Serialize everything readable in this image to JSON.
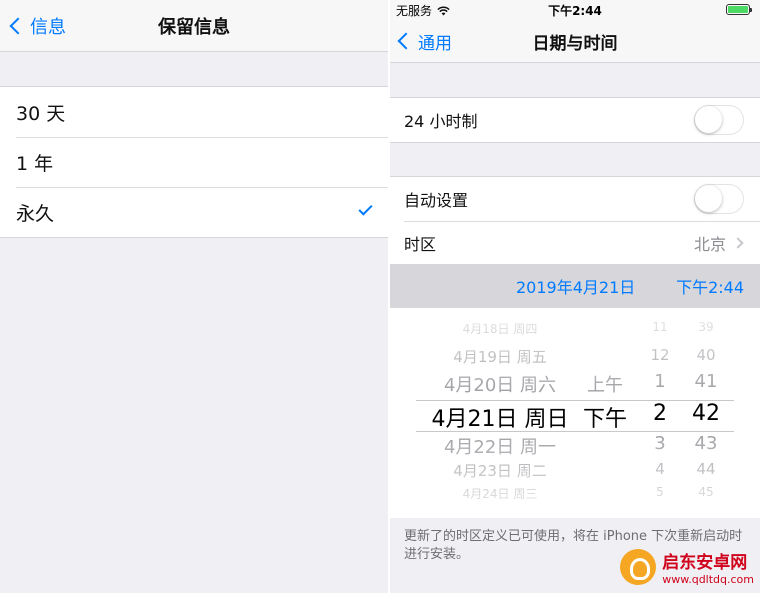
{
  "left": {
    "nav": {
      "back_label": "信息",
      "title": "保留信息"
    },
    "options": [
      {
        "label": "30 天",
        "checked": false
      },
      {
        "label": "1 年",
        "checked": false
      },
      {
        "label": "永久",
        "checked": true
      }
    ]
  },
  "right": {
    "status": {
      "carrier": "无服务",
      "time": "下午2:44",
      "battery_percent": 100
    },
    "nav": {
      "back_label": "通用",
      "title": "日期与时间"
    },
    "clock24": {
      "label": "24 小时制",
      "on": false
    },
    "auto_set": {
      "label": "自动设置",
      "on": false
    },
    "timezone": {
      "label": "时区",
      "value": "北京"
    },
    "datetime_bar": {
      "date": "2019年4月21日",
      "time": "下午2:44"
    },
    "picker": {
      "dates": [
        "4月18日 周四",
        "4月19日 周五",
        "4月20日 周六",
        "4月21日 周日",
        "4月22日 周一",
        "4月23日 周二",
        "4月24日 周三"
      ],
      "ampm": [
        "上午",
        "下午"
      ],
      "hours": [
        "11",
        "12",
        "1",
        "2",
        "3",
        "4",
        "5"
      ],
      "minutes": [
        "39",
        "40",
        "41",
        "42",
        "43",
        "44",
        "45"
      ]
    },
    "footer": "更新了的时区定义已可使用，将在 iPhone 下次重新启动时进行安装。"
  },
  "watermark": {
    "name": "启东安卓网",
    "url": "www.qdltdq.com"
  },
  "colors": {
    "accent": "#007aff",
    "background": "#efeff4",
    "separator": "#d6d6da",
    "battery": "#4cd964"
  }
}
